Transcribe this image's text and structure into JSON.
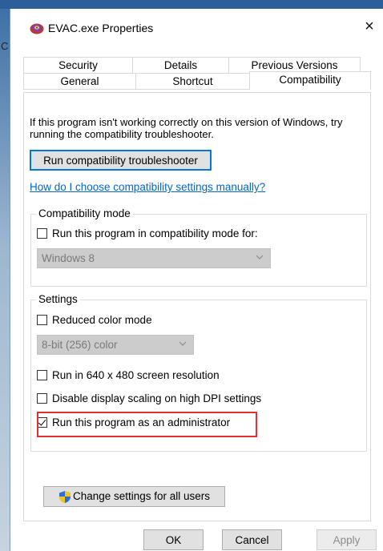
{
  "window": {
    "title": "EVAC.exe Properties",
    "close_glyph": "×"
  },
  "desktop": {
    "edge_letter": "C"
  },
  "tabs_row1": [
    "Security",
    "Details",
    "Previous Versions"
  ],
  "tabs_row2": [
    "General",
    "Shortcut",
    "Compatibility"
  ],
  "selected_tab": "Compatibility",
  "description": "If this program isn't working correctly on this version of Windows, try running the compatibility troubleshooter.",
  "troubleshooter_button": "Run compatibility troubleshooter",
  "help_link": "How do I choose compatibility settings manually?",
  "compat_mode": {
    "legend": "Compatibility mode",
    "checkbox_label": "Run this program in compatibility mode for:",
    "checked": false,
    "select_value": "Windows 8"
  },
  "settings": {
    "legend": "Settings",
    "reduced_color": {
      "label": "Reduced color mode",
      "checked": false
    },
    "color_select_value": "8-bit (256) color",
    "res_640": {
      "label": "Run in 640 x 480 screen resolution",
      "checked": false
    },
    "disable_dpi": {
      "label": "Disable display scaling on high DPI settings",
      "checked": false
    },
    "run_admin": {
      "label": "Run this program as an administrator",
      "checked": true
    }
  },
  "change_all_users_button": "Change settings for all users",
  "buttons": {
    "ok": "OK",
    "cancel": "Cancel",
    "apply": "Apply"
  },
  "colors": {
    "accent": "#0078d7",
    "link": "#0066cc",
    "highlight": "#e03030",
    "disabled_select": "#cccccc"
  }
}
